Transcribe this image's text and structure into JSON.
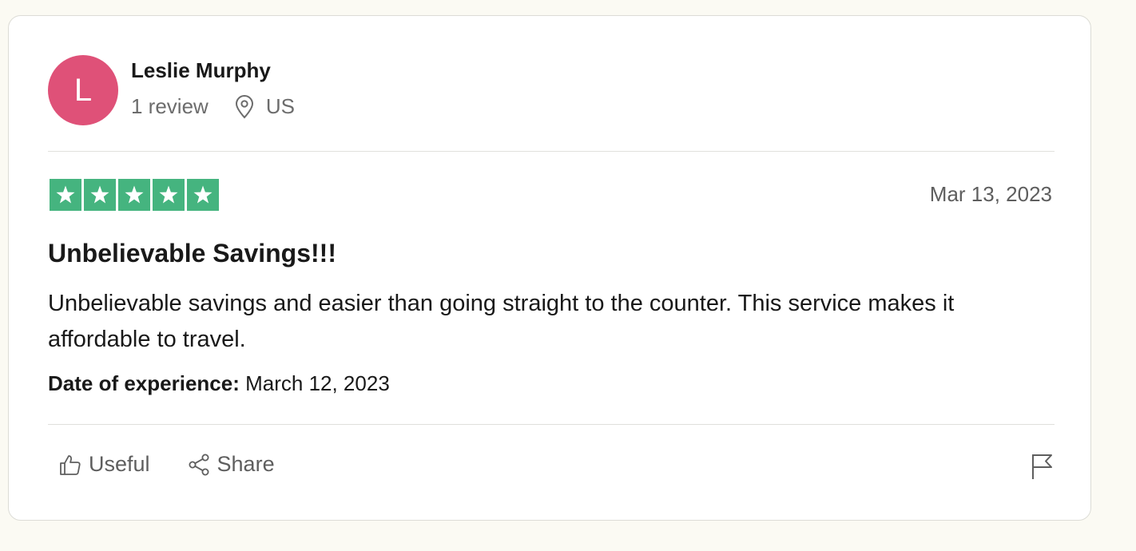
{
  "reviewer": {
    "initial": "L",
    "name": "Leslie Murphy",
    "review_count": "1 review",
    "country": "US"
  },
  "review": {
    "rating": 5,
    "date": "Mar 13, 2023",
    "title": "Unbelievable Savings!!!",
    "body": "Unbelievable savings and easier than going straight to the counter. This service makes it affordable to travel.",
    "experience_label": "Date of experience:",
    "experience_date": "March 12, 2023"
  },
  "actions": {
    "useful_label": "Useful",
    "share_label": "Share"
  },
  "colors": {
    "avatar": "#df5178",
    "star_fill": "#45b47f"
  },
  "icons": {
    "location": "map-pin-icon",
    "useful": "thumbs-up-icon",
    "share": "share-icon",
    "report": "flag-icon",
    "star": "star-icon"
  }
}
